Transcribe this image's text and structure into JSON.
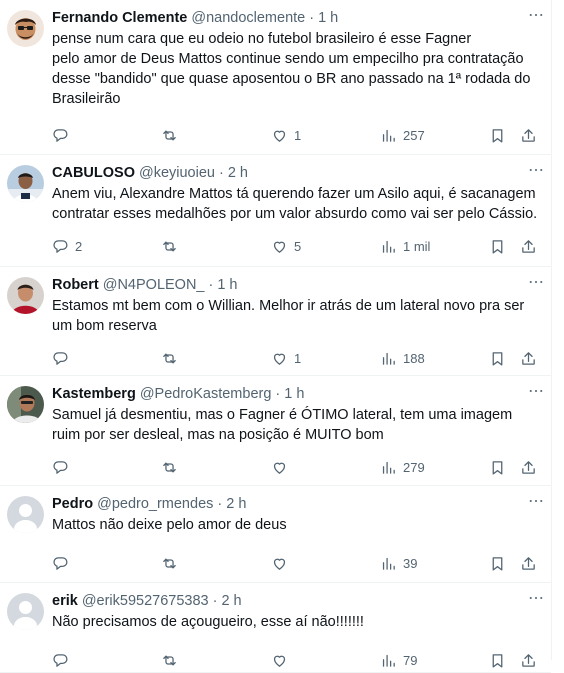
{
  "tweets": [
    {
      "name": "Fernando Clemente",
      "handle": "@nandoclemente",
      "time": "1 h",
      "text": "pense num cara que eu odeio no futebol brasileiro é esse Fagner\npelo amor de Deus Mattos continue sendo um empecilho pra contratação desse \"bandido\" que quase aposentou o BR ano passado na 1ª rodada do Brasileirão",
      "replies": "",
      "retweets": "",
      "likes": "1",
      "views": "257",
      "avatar": "memoji"
    },
    {
      "name": "CABULOSO",
      "handle": "@keyiuoieu",
      "time": "2 h",
      "text": "Anem viu, Alexandre Mattos tá querendo fazer um Asilo aqui, é sacanagem contratar esses medalhões por um valor absurdo como vai ser pelo Cássio.",
      "replies": "2",
      "retweets": "",
      "likes": "5",
      "views": "1 mil",
      "avatar": "photo-blue"
    },
    {
      "name": "Robert",
      "handle": "@N4POLEON_",
      "time": "1 h",
      "text": "Estamos mt bem com o Willian. Melhor ir atrás de um lateral novo pra ser um bom reserva",
      "replies": "",
      "retweets": "",
      "likes": "1",
      "views": "188",
      "avatar": "photo-red"
    },
    {
      "name": "Kastemberg",
      "handle": "@PedroKastemberg",
      "time": "1 h",
      "text": "Samuel já desmentiu, mas o Fagner é ÓTIMO lateral, tem uma imagem ruim por ser desleal, mas na posição é MUITO bom",
      "replies": "",
      "retweets": "",
      "likes": "",
      "views": "279",
      "avatar": "photo-dark"
    },
    {
      "name": "Pedro",
      "handle": "@pedro_rmendes",
      "time": "2 h",
      "text": "Mattos não deixe pelo amor de deus",
      "replies": "",
      "retweets": "",
      "likes": "",
      "views": "39",
      "avatar": "default"
    },
    {
      "name": "erik",
      "handle": "@erik59527675383",
      "time": "2 h",
      "text": "Não precisamos de açougueiro, esse aí não!!!!!!!",
      "replies": "",
      "retweets": "",
      "likes": "",
      "views": "79",
      "avatar": "default"
    }
  ],
  "separator": "·",
  "icons": {
    "reply": "reply-icon",
    "retweet": "retweet-icon",
    "like": "heart-icon",
    "views": "views-icon",
    "bookmark": "bookmark-icon",
    "share": "share-icon",
    "more": "more-icon"
  },
  "colors": {
    "text": "#0f1419",
    "secondary": "#536471",
    "border": "#eff3f4",
    "default_avatar": "#d3d9de"
  }
}
